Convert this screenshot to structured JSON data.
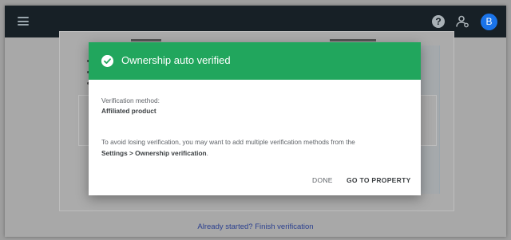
{
  "topbar": {
    "menu_icon": "menu-icon",
    "help_icon": "help-icon",
    "help_glyph": "?",
    "users_icon": "manage-users-icon",
    "avatar_letter": "B"
  },
  "background": {
    "finish_link": "Already started? Finish verification"
  },
  "dialog": {
    "title": "Ownership auto verified",
    "title_icon": "check-circle-icon",
    "method_label": "Verification method:",
    "method_value": "Affiliated product",
    "info_prefix": "To avoid losing verification, you may want to add multiple verification methods from the",
    "info_link_text": "Settings > Ownership verification",
    "info_suffix": ".",
    "done_label": "DONE",
    "go_label": "GO TO PROPERTY"
  },
  "colors": {
    "header_green": "#21a65d",
    "topbar": "#172026",
    "avatar_blue": "#1a73e8"
  }
}
